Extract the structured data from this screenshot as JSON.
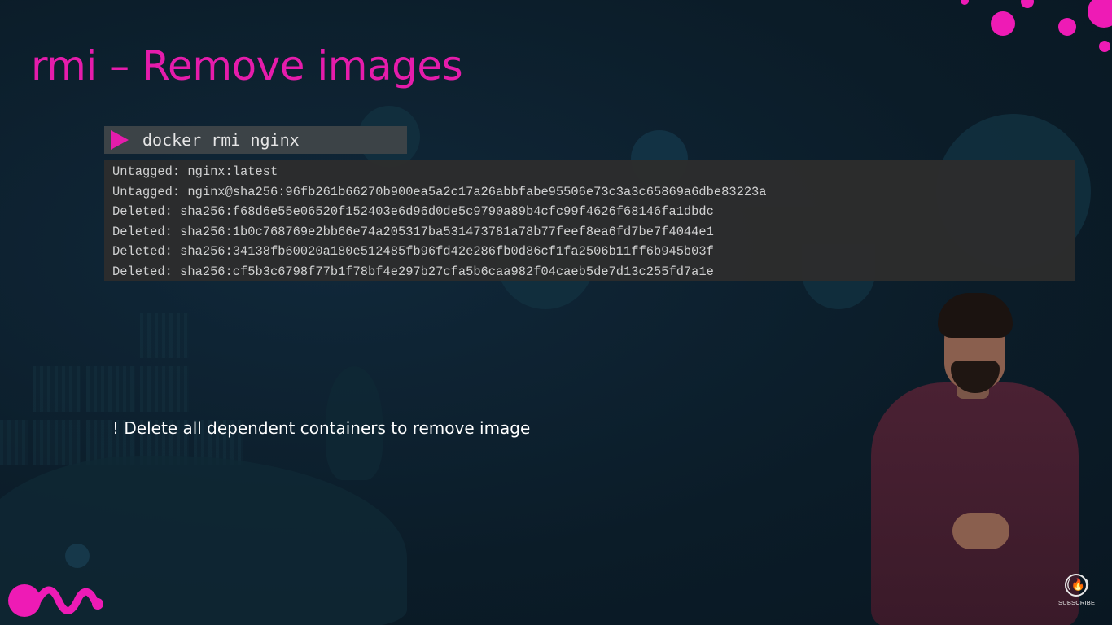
{
  "slide": {
    "title": "rmi – Remove images",
    "command": "docker rmi nginx",
    "output_lines": [
      "Untagged: nginx:latest",
      "Untagged: nginx@sha256:96fb261b66270b900ea5a2c17a26abbfabe95506e73c3a3c65869a6dbe83223a",
      "Deleted: sha256:f68d6e55e06520f152403e6d96d0de5c9790a89b4cfc99f4626f68146fa1dbdc",
      "Deleted: sha256:1b0c768769e2bb66e74a205317ba531473781a78b77feef8ea6fd7be7f4044e1",
      "Deleted: sha256:34138fb60020a180e512485fb96fd42e286fb0d86cf1fa2506b11ff6b945b03f",
      "Deleted: sha256:cf5b3c6798f77b1f78bf4e297b27cfa5b6caa982f04caeb5de7d13c255fd7a1e"
    ],
    "note": "! Delete all dependent containers to remove image"
  },
  "overlay": {
    "subscribe_label": "SUBSCRIBE",
    "subscribe_icon": "freecodecamp-flame-icon"
  },
  "colors": {
    "accent": "#e51cab",
    "background": "#0c1d29",
    "command_bar": "#3c4347",
    "output_box": "#2d2d2d"
  }
}
